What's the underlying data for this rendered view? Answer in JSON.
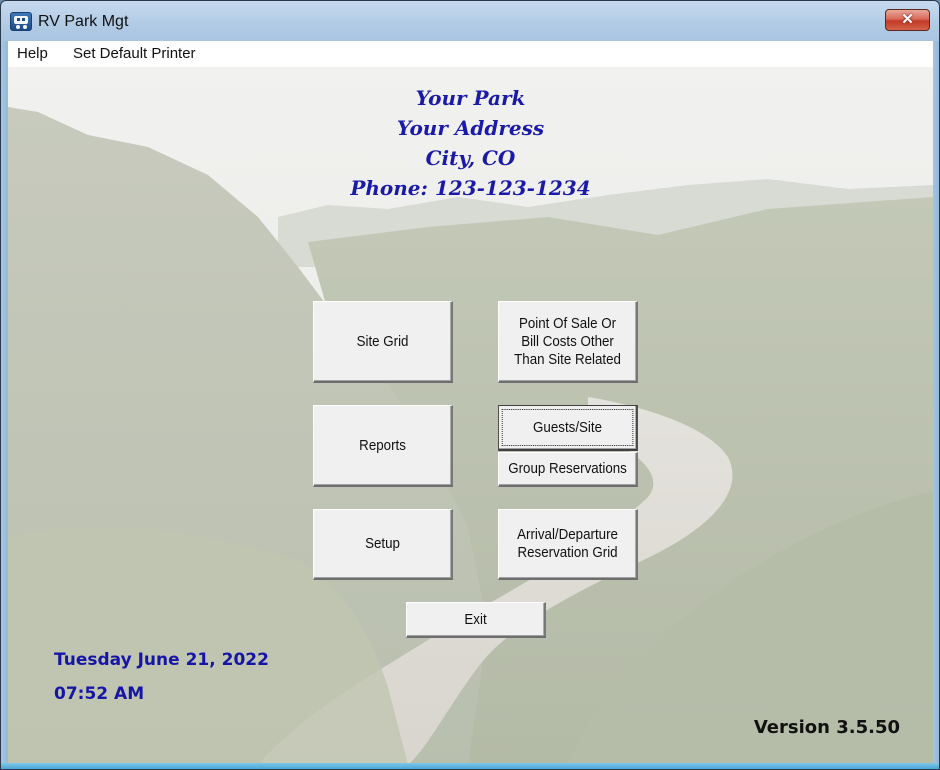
{
  "window": {
    "title": "RV Park Mgt",
    "app_icon": "rv-camper-icon",
    "close_glyph": "✕"
  },
  "menubar": {
    "items": [
      {
        "label": "Help"
      },
      {
        "label": "Set Default Printer"
      }
    ]
  },
  "park_info": {
    "name": "Your Park",
    "address": "Your Address",
    "city_state": "City, CO",
    "phone": "Phone: 123-123-1234"
  },
  "buttons": {
    "site_grid": "Site Grid",
    "point_of_sale": "Point Of Sale Or\nBill Costs Other\nThan Site Related",
    "reports": "Reports",
    "guests_site": "Guests/Site",
    "group_reservations": "Group Reservations",
    "setup": "Setup",
    "arrival_departure": "Arrival/Departure\nReservation Grid",
    "exit": "Exit"
  },
  "status": {
    "date": "Tuesday June 21, 2022",
    "time": "07:52 AM",
    "version": "Version 3.5.50"
  },
  "colors": {
    "header_text": "#1a1aa8",
    "date_text": "#1616a6",
    "close_button": "#c8402a"
  }
}
